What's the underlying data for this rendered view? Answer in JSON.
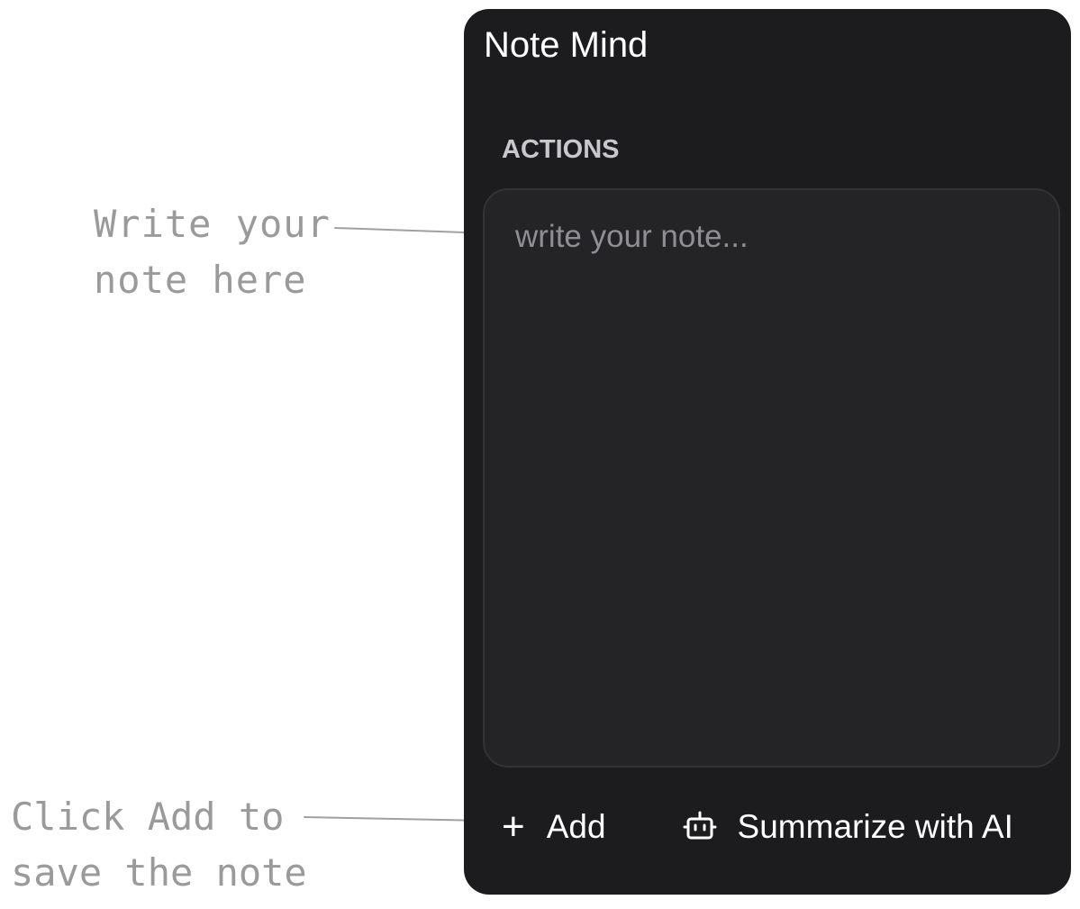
{
  "annotations": {
    "note_hint": "Write your\nnote here",
    "add_hint": "Click Add to\nsave the note"
  },
  "app": {
    "title": "Note Mind"
  },
  "actions_section": {
    "title": "ACTIONS",
    "note_placeholder": "write your note...",
    "note_value": ""
  },
  "buttons": {
    "add_label": "Add",
    "add_icon": "plus-icon",
    "summarize_label": "Summarize with AI",
    "summarize_icon": "robot-icon"
  },
  "colors": {
    "panel_bg": "#1c1c1e",
    "textarea_bg": "#242426",
    "annotation_text": "#9a9a9a",
    "text_primary": "#ffffff",
    "placeholder": "#8e8e93"
  }
}
